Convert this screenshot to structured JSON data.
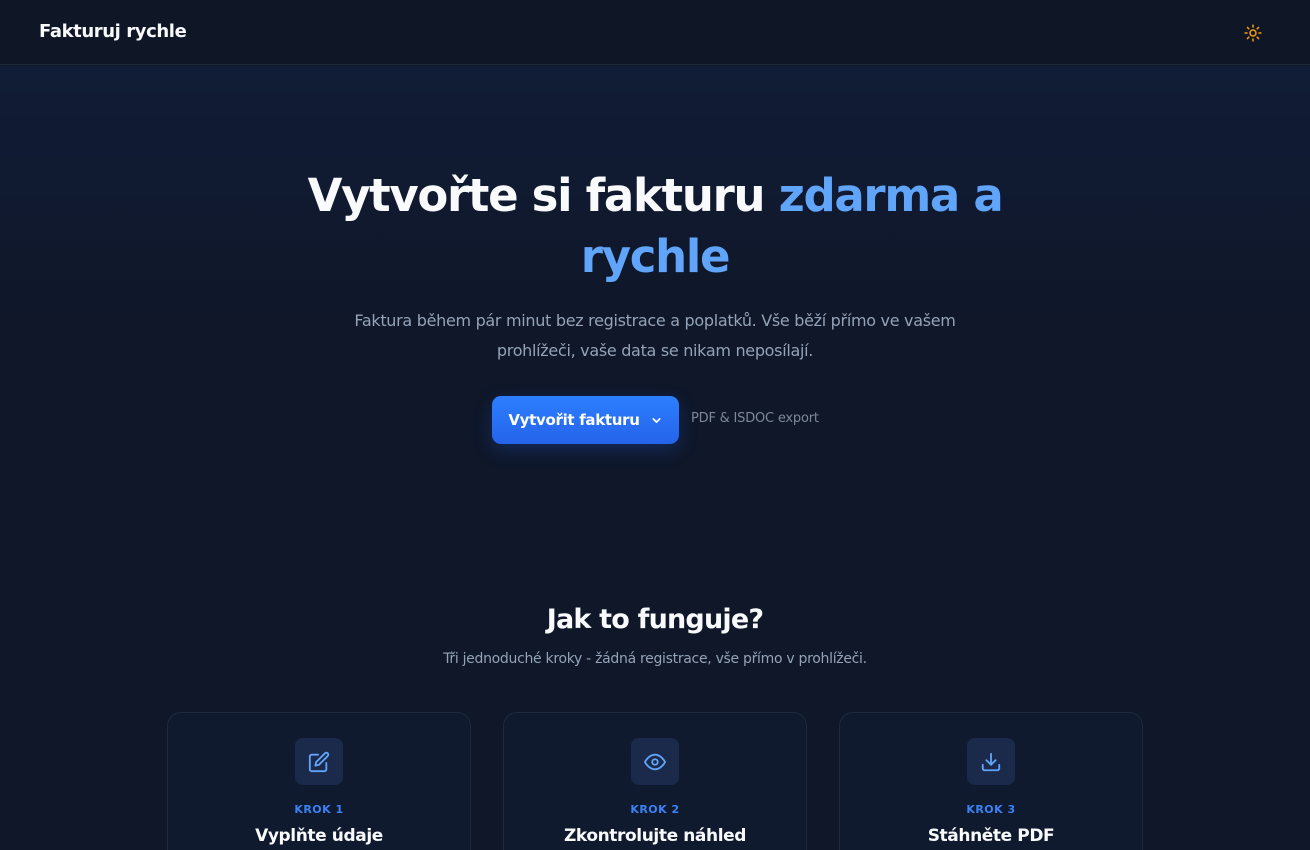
{
  "header": {
    "brand": "Fakturuj rychle",
    "theme_icon": "sun-icon"
  },
  "hero": {
    "title_main": "Vytvořte si fakturu ",
    "title_accent": "zdarma a rychle",
    "subtitle": "Faktura během pár minut bez registrace a poplatků. Vše běží přímo ve vašem prohlížeči, vaše data se nikam neposílají.",
    "cta_label": "Vytvořit fakturu",
    "cta_icon": "chevron-down-icon",
    "export_note": "PDF & ISDOC export"
  },
  "how_it_works": {
    "title": "Jak to funguje?",
    "subtitle": "Tři jednoduché kroky - žádná registrace, vše přímo v prohlížeči.",
    "steps": [
      {
        "step": "KROK 1",
        "title": "Vyplňte údaje",
        "icon": "edit-icon"
      },
      {
        "step": "KROK 2",
        "title": "Zkontrolujte náhled",
        "icon": "eye-icon"
      },
      {
        "step": "KROK 3",
        "title": "Stáhněte PDF",
        "icon": "download-icon"
      }
    ]
  },
  "colors": {
    "background": "#0f1729",
    "accent": "#60a5fa",
    "button": "#2563eb",
    "sun": "#f59e0b"
  }
}
